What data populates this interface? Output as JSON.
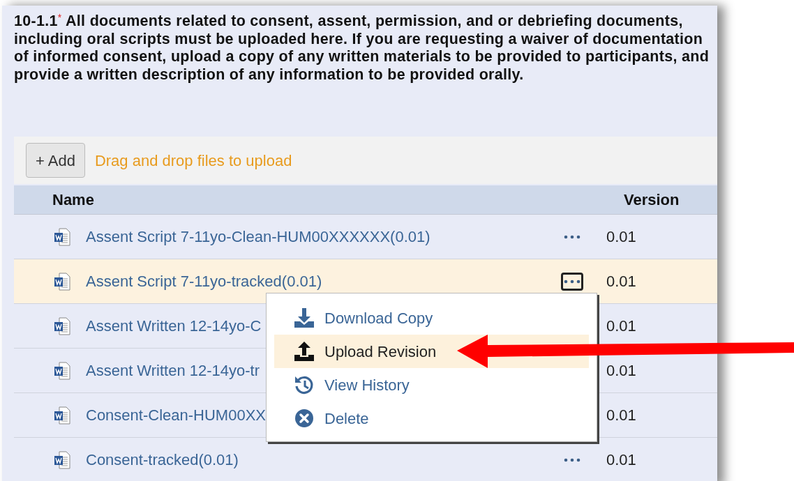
{
  "question": {
    "number": "10-1.1",
    "required_mark": "*",
    "text": "All documents related to consent, assent, permission, and or debriefing documents, including oral scripts must be uploaded here. If you are requesting a waiver of documentation of informed consent, upload a copy of any written materials to be provided to participants, and provide a written description of any information to be provided orally."
  },
  "toolbar": {
    "add_button": "+ Add",
    "drop_hint": "Drag and drop files to upload"
  },
  "table": {
    "columns": [
      "Name",
      "Version"
    ],
    "rows": [
      {
        "name": "Assent Script 7-11yo-Clean-HUM00XXXXXX(0.01)",
        "version": "0.01",
        "selected": false,
        "menu_open": false
      },
      {
        "name": "Assent Script 7-11yo-tracked(0.01)",
        "version": "0.01",
        "selected": true,
        "menu_open": true
      },
      {
        "name": "Assent Written 12-14yo-C",
        "version": "0.01",
        "selected": false,
        "menu_open": false
      },
      {
        "name": "Assent Written 12-14yo-tr",
        "version": "0.01",
        "selected": false,
        "menu_open": false
      },
      {
        "name": "Consent-Clean-HUM00XX",
        "version": "0.01",
        "selected": false,
        "menu_open": false
      },
      {
        "name": "Consent-tracked(0.01)",
        "version": "0.01",
        "selected": false,
        "menu_open": false
      }
    ]
  },
  "context_menu": {
    "items": [
      {
        "kind": "download",
        "label": "Download Copy",
        "highlighted": false
      },
      {
        "kind": "upload",
        "label": "Upload Revision",
        "highlighted": true
      },
      {
        "kind": "history",
        "label": "View History",
        "highlighted": false
      },
      {
        "kind": "delete",
        "label": "Delete",
        "highlighted": false
      }
    ]
  }
}
